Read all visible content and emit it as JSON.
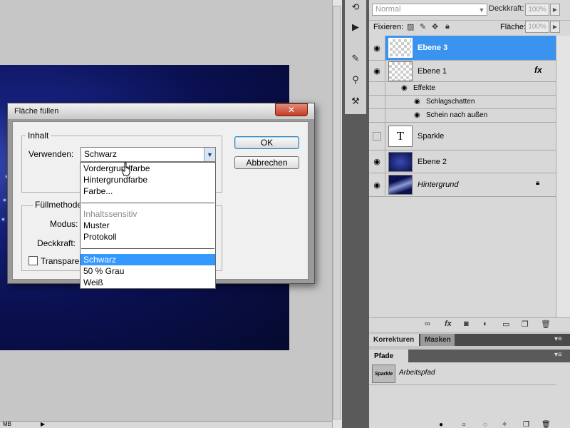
{
  "dialog": {
    "title": "Fläche füllen",
    "close_symbol": "✕",
    "group_content": "Inhalt",
    "use_label": "Verwenden:",
    "use_value": "Schwarz",
    "group_fill": "Füllmethode",
    "mode_label": "Modus:",
    "opacity_label": "Deckkraft:",
    "preserve_transparency": "Transparenz erhalten",
    "ok": "OK",
    "cancel": "Abbrechen",
    "options_group1": [
      "Vordergrundfarbe",
      "Hintergrundfarbe",
      "Farbe..."
    ],
    "options_group2": [
      "Inhaltssensitiv",
      "Muster",
      "Protokoll"
    ],
    "options_group3": [
      "Schwarz",
      "50 % Grau",
      "Weiß"
    ]
  },
  "layers_panel": {
    "blend_mode": "Normal",
    "opacity_label": "Deckkraft:",
    "opacity_value": "100%",
    "lock_label": "Fixieren:",
    "fill_label": "Fläche:",
    "fill_value": "100%",
    "layers": [
      {
        "name": "Ebene 3",
        "selected": true
      },
      {
        "name": "Ebene 1",
        "fx": "fx"
      },
      {
        "name": "Effekte"
      },
      {
        "name": "Schlagschatten"
      },
      {
        "name": "Schein nach außen"
      },
      {
        "name": "Sparkle",
        "thumb": "T"
      },
      {
        "name": "Ebene 2"
      },
      {
        "name": "Hintergrund"
      }
    ]
  },
  "tabs": {
    "korrekturen": "Korrekturen",
    "masken": "Masken",
    "pfade": "Pfade"
  },
  "paths": {
    "thumb_label": "Sparkle",
    "name": "Arbeitspfad"
  },
  "status": {
    "text": "MB"
  },
  "colors": {
    "accent": "#3399ff",
    "selected_layer": "#3b93f0",
    "panel": "#d8d8d8",
    "dark": "#5a5a5a"
  }
}
